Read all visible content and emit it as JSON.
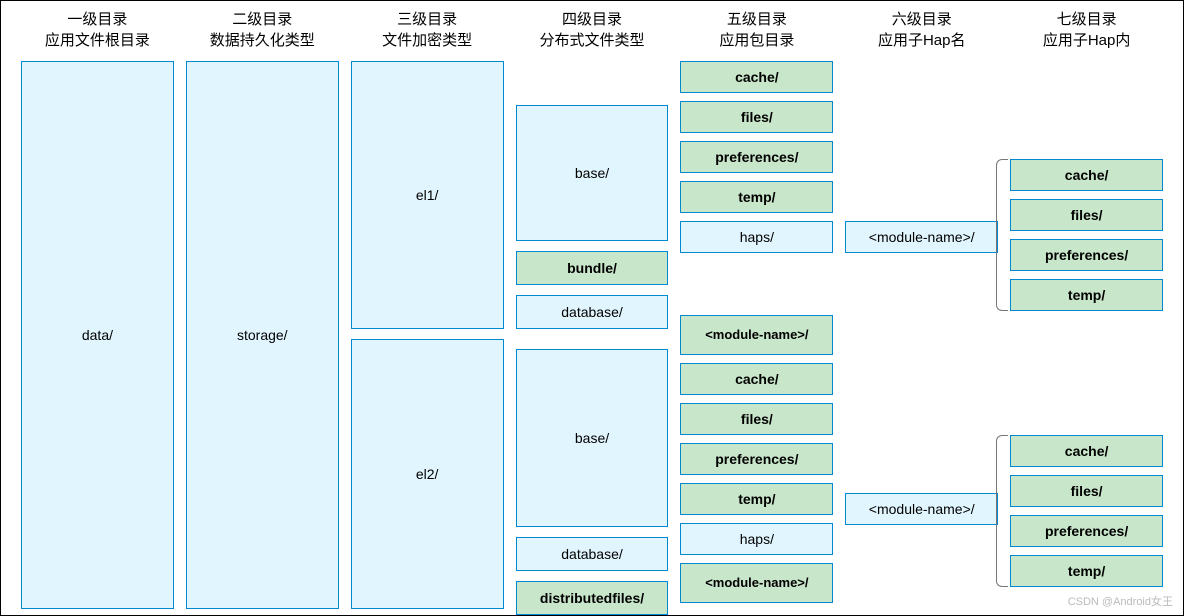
{
  "headers": {
    "c1a": "一级目录",
    "c1b": "应用文件根目录",
    "c2a": "二级目录",
    "c2b": "数据持久化类型",
    "c3a": "三级目录",
    "c3b": "文件加密类型",
    "c4a": "四级目录",
    "c4b": "分布式文件类型",
    "c5a": "五级目录",
    "c5b": "应用包目录",
    "c6a": "六级目录",
    "c6b": "应用子Hap名",
    "c7a": "七级目录",
    "c7b": "应用子Hap内"
  },
  "c1": {
    "data": "data/"
  },
  "c2": {
    "storage": "storage/"
  },
  "c3": {
    "el1": "el1/",
    "el2": "el2/"
  },
  "c4": {
    "base1": "base/",
    "bundle": "bundle/",
    "db1": "database/",
    "base2": "base/",
    "db2": "database/",
    "dist": "distributedfiles/"
  },
  "c5": {
    "cache1": "cache/",
    "files1": "files/",
    "prefs1": "preferences/",
    "temp1": "temp/",
    "haps1": "haps/",
    "module1": "<module-name>/",
    "cache2": "cache/",
    "files2": "files/",
    "prefs2": "preferences/",
    "temp2": "temp/",
    "haps2": "haps/",
    "module2": "<module-name>/"
  },
  "c6": {
    "module1": "<module-name>/",
    "module2": "<module-name>/"
  },
  "c7": {
    "cache1": "cache/",
    "files1": "files/",
    "prefs1": "preferences/",
    "temp1": "temp/",
    "cache2": "cache/",
    "files2": "files/",
    "prefs2": "preferences/",
    "temp2": "temp/"
  },
  "watermark": "CSDN @Android女王"
}
